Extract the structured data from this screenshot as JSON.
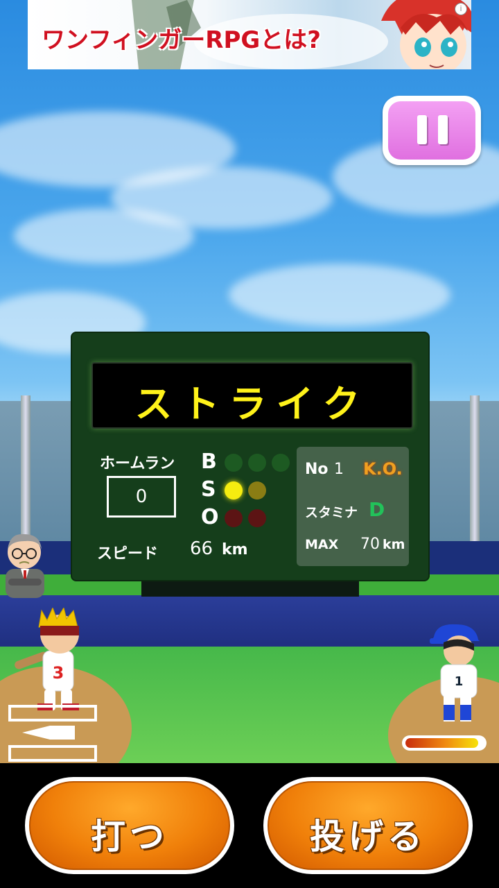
{
  "ad": {
    "text": "ワンフィンガーRPGとは?",
    "info": "i"
  },
  "scoreboard": {
    "message": "ストライク",
    "homerun_label": "ホームラン",
    "homerun_value": "0",
    "speed_label": "スピード",
    "speed_value": "66",
    "speed_unit": "km",
    "bso": {
      "b": "B",
      "s": "S",
      "o": "O",
      "balls": 0,
      "strikes": 1,
      "outs": 0
    },
    "info": {
      "no_label": "No",
      "no_value": "1",
      "status": "K.O.",
      "stamina_label": "スタミナ",
      "stamina_grade": "D",
      "max_label": "MAX",
      "max_value": "70",
      "max_unit": "km"
    }
  },
  "players": {
    "batter_number": "3",
    "pitcher_number": "1"
  },
  "pitcher_stamina_level": 0.94,
  "buttons": {
    "hit": "打つ",
    "throw": "投げる"
  },
  "colors": {
    "message": "#fff21a",
    "status": "#f0a020",
    "grade": "#22c25a",
    "button": "#f0800a",
    "pause": "#e070e0"
  }
}
